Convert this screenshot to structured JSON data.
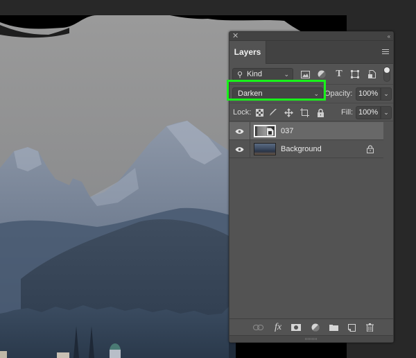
{
  "panel": {
    "close_glyph": "✕",
    "collapse_glyph": "‹‹",
    "tab_label": "Layers",
    "filter": {
      "kind_label": "Kind",
      "icons": [
        "image-filter-icon",
        "adjustment-filter-icon",
        "type-filter-icon",
        "shape-filter-icon",
        "smart-object-filter-icon"
      ]
    },
    "blend_mode": "Darken",
    "opacity_label": "Opacity:",
    "opacity_value": "100%",
    "lock_label": "Lock:",
    "fill_label": "Fill:",
    "fill_value": "100%",
    "layers": [
      {
        "name": "037",
        "visible": true,
        "selected": true,
        "locked": false,
        "type": "smart-object"
      },
      {
        "name": "Background",
        "visible": true,
        "selected": false,
        "locked": true,
        "type": "image"
      }
    ],
    "footer_icons": [
      "link-layers-icon",
      "fx-icon",
      "add-mask-icon",
      "new-adjustment-icon",
      "new-group-icon",
      "new-layer-icon",
      "delete-layer-icon"
    ],
    "fx_label": "fx"
  },
  "colors": {
    "highlight": "#18f21a",
    "panel_bg": "#535353",
    "selected_layer": "#686868"
  }
}
